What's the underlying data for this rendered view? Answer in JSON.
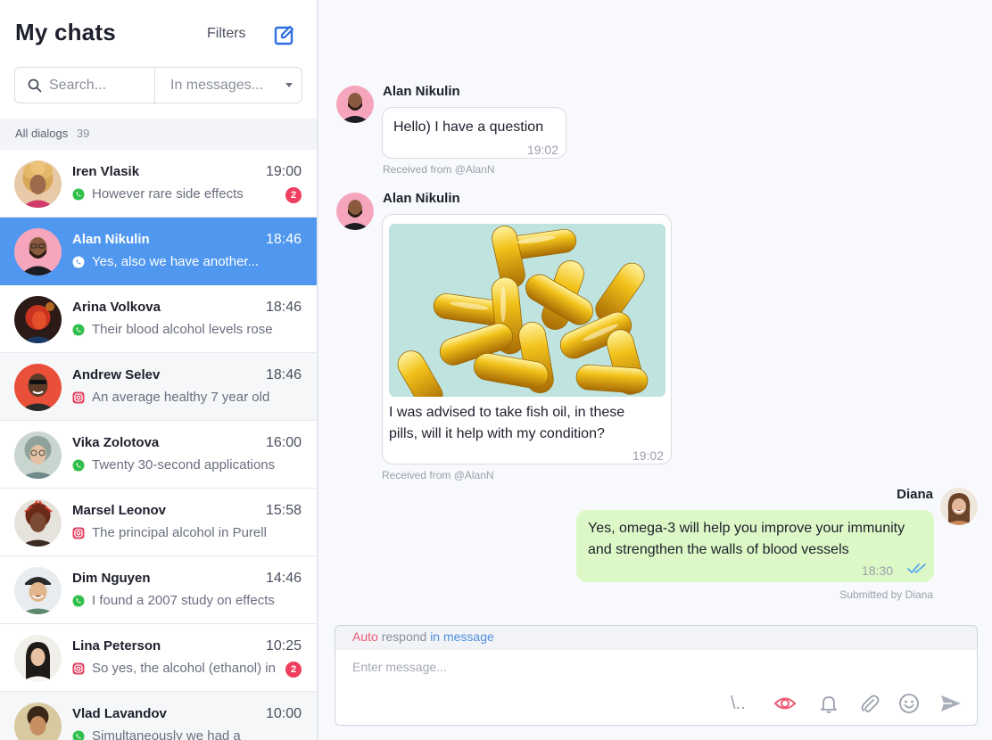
{
  "sidebar": {
    "title": "My chats",
    "filters_label": "Filters",
    "search_placeholder": "Search...",
    "scope_label": "In messages...",
    "all_dialogs_label": "All dialogs",
    "all_dialogs_count": "39",
    "chats": [
      {
        "name": "Iren Vlasik",
        "time": "19:00",
        "preview": "However rare side effects",
        "channel": "whatsapp-icon",
        "badge": "2"
      },
      {
        "name": "Alan Nikulin",
        "time": "18:46",
        "preview": "Yes, also we have another...",
        "channel": "whatsapp-icon",
        "badge": ""
      },
      {
        "name": "Arina Volkova",
        "time": "18:46",
        "preview": "Their blood alcohol levels rose",
        "channel": "whatsapp-icon",
        "badge": ""
      },
      {
        "name": "Andrew Selev",
        "time": "18:46",
        "preview": "An average healthy 7 year old",
        "channel": "instagram-icon",
        "badge": ""
      },
      {
        "name": "Vika Zolotova",
        "time": "16:00",
        "preview": "Twenty 30-second applications",
        "channel": "whatsapp-icon",
        "badge": ""
      },
      {
        "name": "Marsel Leonov",
        "time": "15:58",
        "preview": "The principal alcohol in Purell",
        "channel": "instagram-icon",
        "badge": ""
      },
      {
        "name": "Dim Nguyen",
        "time": "14:46",
        "preview": "I found a 2007 study on effects",
        "channel": "whatsapp-icon",
        "badge": ""
      },
      {
        "name": "Lina Peterson",
        "time": "10:25",
        "preview": "So yes, the alcohol (ethanol) in",
        "channel": "instagram-icon",
        "badge": "2"
      },
      {
        "name": "Vlad Lavandov",
        "time": "10:00",
        "preview": "Simultaneously we had a",
        "channel": "whatsapp-icon",
        "badge": ""
      }
    ]
  },
  "conversation": {
    "messages": [
      {
        "sender": "Alan Nikulin",
        "text": "Hello) I have a question",
        "time": "19:02",
        "meta": "Received from @AlanN"
      },
      {
        "sender": "Alan Nikulin",
        "text": "I was advised to take fish oil, in these pills, will it help with my condition?",
        "time": "19:02",
        "meta": "Received from @AlanN",
        "has_image": true
      },
      {
        "sender": "Diana",
        "text": "Yes, omega-3 will help you improve your immunity and strengthen the walls of blood vessels",
        "time": "18:30",
        "meta": "Submitted by Diana"
      }
    ]
  },
  "composer": {
    "auto_label": "Auto",
    "respond_label": "respond",
    "in_message_label": "in message",
    "placeholder": "Enter message...",
    "template_label": "\\.."
  },
  "colors": {
    "accent": "#4f97ef",
    "badge": "#ef3f5e",
    "outgoing_bubble": "#dcf8c6",
    "whatsapp": "#2fbf4a",
    "instagram": "#e4405f"
  }
}
